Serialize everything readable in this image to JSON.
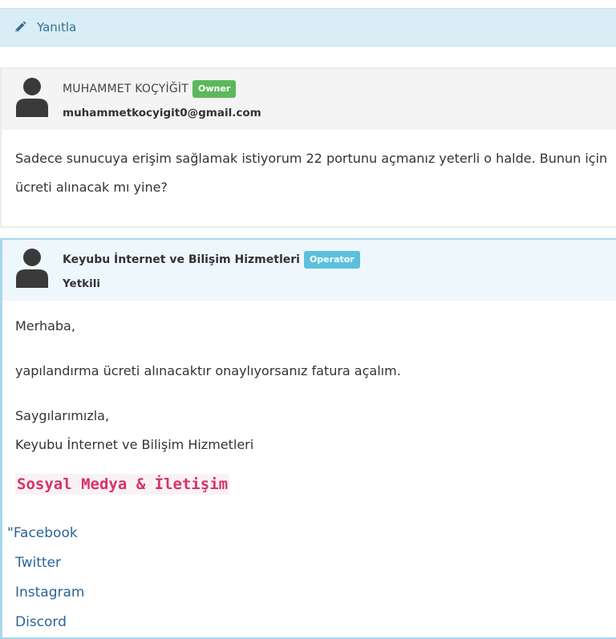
{
  "reply_bar": {
    "label": "Yanıtla",
    "icon": "pencil-icon"
  },
  "messages": [
    {
      "author": "MUHAMMET KOÇYİĞİT",
      "badge": "Owner",
      "subline": "muhammetkocyigit0@gmail.com",
      "lines": [
        "Sadece sunucuya erişim sağlamak istiyorum 22 portunu açmanız yeterli o halde. Bunun için",
        "ücreti alınacak mı yine?"
      ]
    },
    {
      "author": "Keyubu İnternet ve Bilişim Hizmetleri",
      "badge": "Operator",
      "subline": "Yetkili",
      "greeting": "Merhaba,",
      "body": "yapılandırma ücreti alınacaktır onaylıyorsanız fatura açalım.",
      "closing": "Saygılarımızla,",
      "signature": "Keyubu İnternet ve Bilişim Hizmetleri",
      "social_heading": "Sosyal Medya & İletişim",
      "links": [
        "\"Facebook",
        "Twitter",
        "Instagram",
        "Discord"
      ]
    }
  ],
  "colors": {
    "reply_bg": "#d9edf7",
    "reply_text": "#31708f",
    "owner_badge": "#5cb85c",
    "operator_badge": "#5bc0de",
    "link": "#2a6496",
    "heading_pink": "#d6336c"
  }
}
